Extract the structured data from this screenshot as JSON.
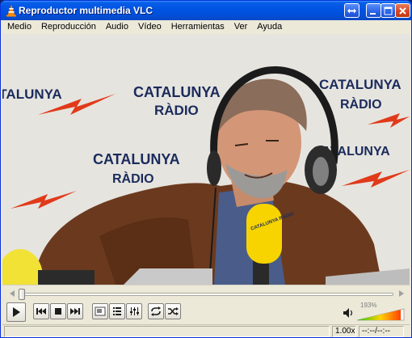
{
  "window": {
    "title": "Reproductor multimedia VLC"
  },
  "menu": {
    "items": [
      "Medio",
      "Reproducción",
      "Audio",
      "Vídeo",
      "Herramientas",
      "Ver",
      "Ayuda"
    ]
  },
  "video": {
    "backdrop_text": [
      "CATALUNYA",
      "RÀDIO"
    ],
    "mic_text": "CATALUNYA RÀDIO"
  },
  "seek": {
    "position": 0.005
  },
  "controls": {
    "buttons": [
      "play-icon",
      "previous-icon",
      "stop-icon",
      "next-icon",
      "fullscreen-icon",
      "playlist-icon",
      "extended-settings-icon",
      "loop-icon",
      "shuffle-icon"
    ]
  },
  "volume": {
    "percent_label": "193%",
    "level": 0.93
  },
  "status": {
    "speed": "1.00x",
    "time": "--:--/--:--"
  },
  "colors": {
    "titlebar": "#0054e3",
    "accent_orange": "#ff8800",
    "backdrop_red": "#e03a1a",
    "backdrop_navy": "#1a2b5c"
  }
}
